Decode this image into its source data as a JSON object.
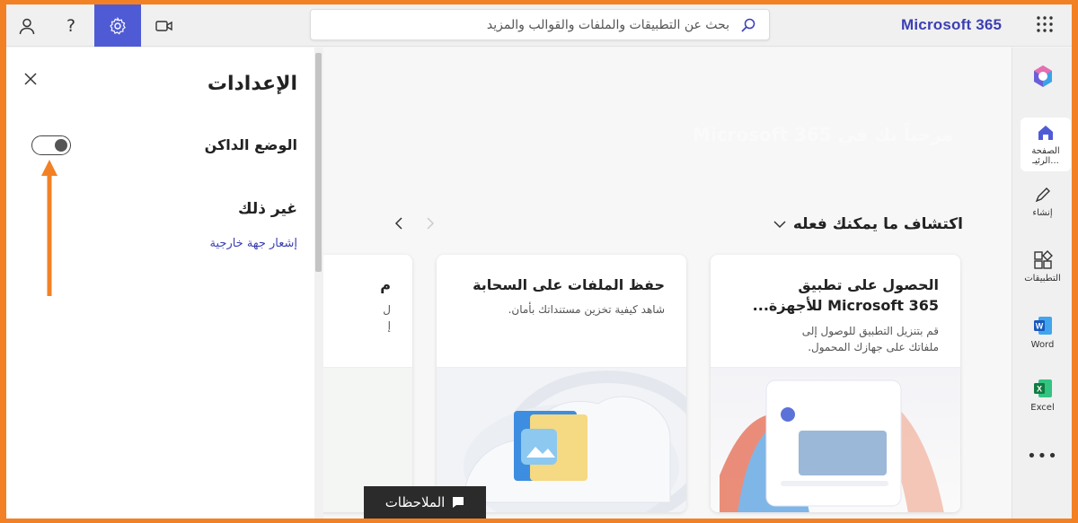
{
  "topbar": {
    "brand": "Microsoft 365",
    "search_placeholder": "بحث عن التطبيقات والملفات والقوالب والمزيد",
    "icons": [
      "account-icon",
      "help-icon",
      "gear-icon",
      "video-icon",
      "search-icon",
      "waffle-icon"
    ]
  },
  "settings": {
    "title": "الإعدادات",
    "dark_mode_label": "الوضع الداكن",
    "dark_mode_on": false,
    "other_label": "غير ذلك",
    "third_party_notice": "إشعار جهة خارجية"
  },
  "main": {
    "hero_text": "مرحباً بك في Microsoft 365",
    "section_title": "اكتشاف ما يمكنك فعله",
    "cards": [
      {
        "title_line1": "الحصول على تطبيق",
        "title_line2": "Microsoft 365 للأجهزة...",
        "desc_line1": "قم بتنزيل التطبيق للوصول إلى",
        "desc_line2": "ملفاتك على جهازك المحمول."
      },
      {
        "title_line1": "حفظ الملفات على السحابة",
        "desc_line1": "شاهد كيفية تخزين مستنداتك بأمان."
      },
      {
        "title_line1": "م",
        "desc_line1": "ل",
        "desc_line2": "إ"
      }
    ],
    "notes_button": "الملاحظات"
  },
  "rail": {
    "home": "الصفحة الرئيـ...",
    "create": "إنشاء",
    "apps": "التطبيقات",
    "word": "Word",
    "excel": "Excel"
  },
  "colors": {
    "accent": "#4f5bd5",
    "brand": "#3b3fb3",
    "annotation": "#f28125"
  }
}
